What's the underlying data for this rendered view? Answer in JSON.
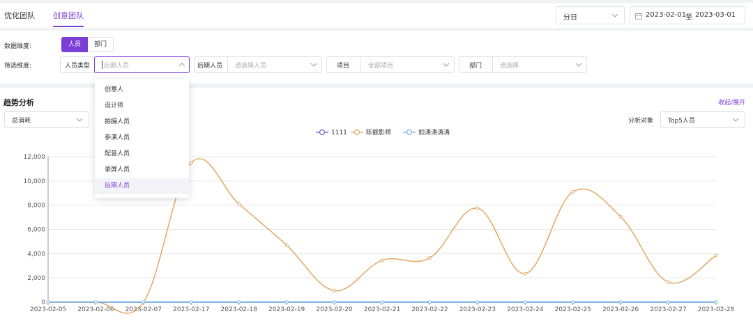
{
  "tabs": [
    {
      "label": "优化团队"
    },
    {
      "label": "创意团队"
    }
  ],
  "period": {
    "value": "分日"
  },
  "date_range": {
    "start": "2023-02-01",
    "separator": "至",
    "end": "2023-03-01"
  },
  "filters": {
    "dimension_label": "数据维度:",
    "dimension_options": [
      "人员",
      "部门"
    ],
    "dimension_selected": "人员",
    "screen_label": "筛选维度:",
    "person_type": {
      "label": "人员类型",
      "placeholder": "后期人员"
    },
    "post_person": {
      "label": "后期人员",
      "placeholder": "请选择人员"
    },
    "project": {
      "label": "项目",
      "placeholder": "全部项目"
    },
    "department": {
      "label": "部门",
      "placeholder": "请选择"
    }
  },
  "dropdown": {
    "options": [
      "创意人",
      "设计师",
      "拍摄人员",
      "参演人员",
      "配音人员",
      "录屏人员",
      "后期人员"
    ],
    "selected": "后期人员"
  },
  "trend": {
    "title": "趋势分析",
    "collapse_label": "收起/展开",
    "metric": "总消耗",
    "target_label": "分析对象",
    "target_value": "Top5人员"
  },
  "colors": {
    "accent": "#7b3fd6",
    "series1": "#6c5ecf",
    "series2": "#e2a862",
    "series3": "#75b6e0"
  },
  "chart_data": {
    "type": "line",
    "x": [
      "2023-02-05",
      "2023-02-06",
      "2023-02-07",
      "2023-02-17",
      "2023-02-18",
      "2023-02-19",
      "2023-02-20",
      "2023-02-21",
      "2023-02-22",
      "2023-02-23",
      "2023-02-24",
      "2023-02-25",
      "2023-02-26",
      "2023-02-27",
      "2023-02-28"
    ],
    "yticks": [
      "0",
      "2,000",
      "4,000",
      "6,000",
      "8,000",
      "10,000",
      "12,000"
    ],
    "ylim": [
      0,
      12000
    ],
    "grid": true,
    "legend_position": "top-center",
    "series": [
      {
        "name": "1111",
        "color": "#6c5ecf",
        "values": [
          0,
          0,
          0,
          0,
          0,
          0,
          0,
          0,
          0,
          0,
          0,
          0,
          0,
          0,
          0
        ]
      },
      {
        "name": "陈靓影师",
        "color": "#e2a862",
        "values": [
          0,
          0,
          0,
          11500,
          8100,
          4700,
          950,
          3450,
          3650,
          7750,
          2350,
          9100,
          7050,
          1650,
          3850
        ]
      },
      {
        "name": "如涛涛涛涛",
        "color": "#75b6e0",
        "values": [
          0,
          0,
          0,
          0,
          0,
          0,
          0,
          0,
          0,
          0,
          0,
          0,
          0,
          0,
          0
        ]
      }
    ]
  }
}
